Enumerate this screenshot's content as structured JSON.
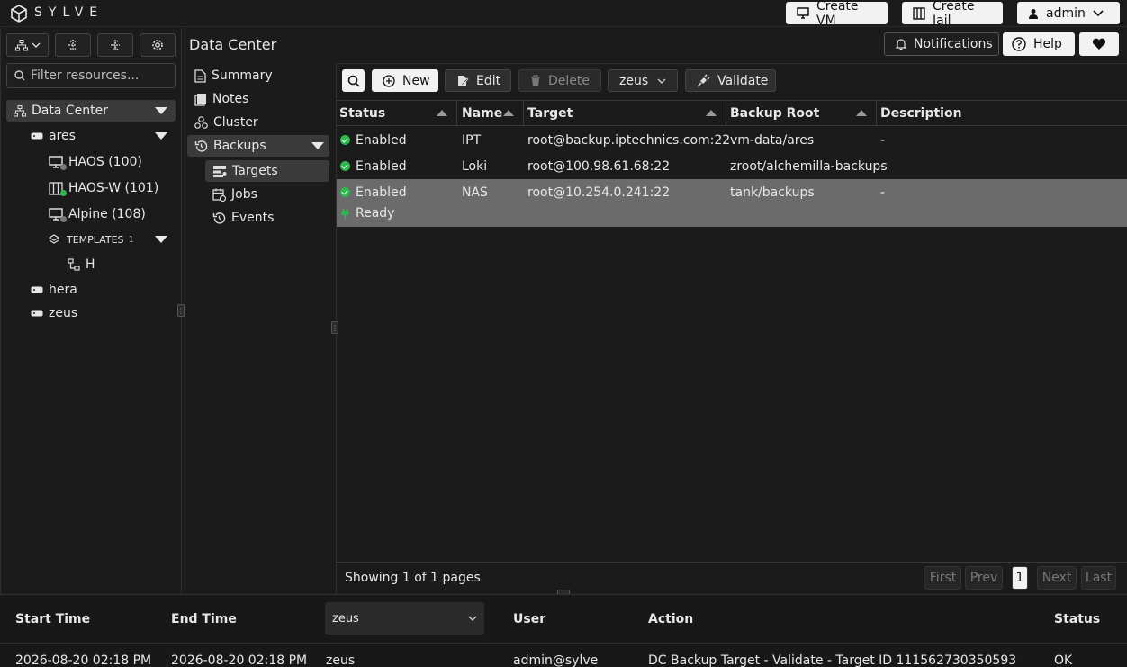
{
  "app": {
    "brand": "SYLVE"
  },
  "topbar": {
    "create_vm": "Create VM",
    "create_jail": "Create Jail",
    "user": "admin"
  },
  "sidebar": {
    "filter_placeholder": "Filter resources...",
    "tree": {
      "datacenter": "Data Center",
      "nodes": [
        {
          "label": "ares",
          "children": [
            "HAOS (100)",
            "HAOS-W (101)",
            "Alpine (108)"
          ],
          "templates": {
            "label": "TEMPLATES",
            "count": "1",
            "items": [
              "H"
            ]
          }
        },
        {
          "label": "hera"
        },
        {
          "label": "zeus"
        }
      ]
    }
  },
  "header": {
    "title": "Data Center",
    "notifications": "Notifications",
    "help": "Help"
  },
  "nav": {
    "summary": "Summary",
    "notes": "Notes",
    "cluster": "Cluster",
    "backups": "Backups",
    "targets": "Targets",
    "jobs": "Jobs",
    "events": "Events"
  },
  "toolbar": {
    "new": "New",
    "edit": "Edit",
    "delete": "Delete",
    "node": "zeus",
    "validate": "Validate"
  },
  "table": {
    "columns": [
      "Status",
      "Name",
      "Target",
      "Backup Root",
      "Description"
    ],
    "rows": [
      {
        "status": "Enabled",
        "name": "IPT",
        "target": "root@backup.iptechnics.com:22",
        "root": "vm-data/ares",
        "desc": "-"
      },
      {
        "status": "Enabled",
        "name": "Loki",
        "target": "root@100.98.61.68:22",
        "root": "zroot/alchemilla-backups",
        "desc": "-"
      },
      {
        "status": "Enabled",
        "name": "NAS",
        "target": "root@10.254.0.241:22",
        "root": "tank/backups",
        "desc": "-",
        "sub_status": "Ready"
      }
    ],
    "showing": "Showing 1 of 1 pages",
    "pager": {
      "first": "First",
      "prev": "Prev",
      "page": "1",
      "next": "Next",
      "last": "Last"
    }
  },
  "log": {
    "columns": {
      "start": "Start Time",
      "end": "End Time",
      "user": "User",
      "action": "Action",
      "status": "Status"
    },
    "node_filter": "zeus",
    "row": {
      "start": "2026-08-20 02:18 PM",
      "end": "2026-08-20 02:18 PM",
      "node": "zeus",
      "user": "admin@sylve",
      "action": "DC Backup Target - Validate - Target ID 111562730350593",
      "status": "OK"
    }
  },
  "colors": {
    "accent_green": "#2fb84f",
    "selected_row": "#6b6b6b",
    "active_nav": "#3a3a3a"
  }
}
